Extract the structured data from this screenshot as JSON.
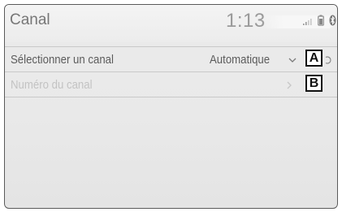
{
  "header": {
    "title": "Canal",
    "clock": "1:13",
    "status_icons": [
      "signal-icon",
      "battery-icon",
      "bluetooth-icon"
    ]
  },
  "rows": [
    {
      "label": "Sélectionner un canal",
      "value": "Automatique",
      "icon": "chevron-down-icon",
      "enabled": true
    },
    {
      "label": "Numéro du canal",
      "value": "",
      "icon": "chevron-right-icon",
      "enabled": false
    }
  ],
  "callouts": [
    "A",
    "B"
  ],
  "colors": {
    "background": "#e9e9e9",
    "text": "#5c5c5c",
    "disabled_text": "#c3c3c3",
    "divider": "#c9c9c9"
  }
}
